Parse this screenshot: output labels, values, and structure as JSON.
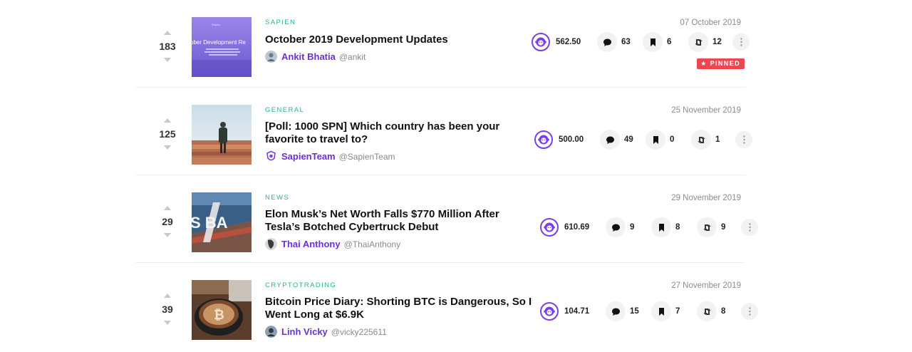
{
  "posts": [
    {
      "votes": "183",
      "category": "SAPIEN",
      "title": "October 2019 Development Updates",
      "author": "Ankit Bhatia",
      "handle": "@ankit",
      "date": "07 October 2019",
      "spn": "562.50",
      "comments": "63",
      "bookmarks": "6",
      "reposts": "12",
      "pinned": "PINNED",
      "thumb_text": "ober Development Re"
    },
    {
      "votes": "125",
      "category": "GENERAL",
      "title": "[Poll: 1000 SPN] Which country has been your favorite to travel to?",
      "author": "SapienTeam",
      "handle": "@SapienTeam",
      "date": "25 November 2019",
      "spn": "500.00",
      "comments": "49",
      "bookmarks": "0",
      "reposts": "1"
    },
    {
      "votes": "29",
      "category": "NEWS",
      "title": "Elon Musk’s Net Worth Falls $770 Million After Tesla’s Botched Cybertruck Debut",
      "author": "Thai Anthony",
      "handle": "@ThaiAnthony",
      "date": "29 November 2019",
      "spn": "610.69",
      "comments": "9",
      "bookmarks": "8",
      "reposts": "9",
      "thumb_text": "S BA"
    },
    {
      "votes": "39",
      "category": "CRYPTOTRADING",
      "title": "Bitcoin Price Diary: Shorting BTC is Dangerous, So I Went Long at $6.9K",
      "author": "Linh Vicky",
      "handle": "@vicky225611",
      "date": "27 November 2019",
      "spn": "104.71",
      "comments": "15",
      "bookmarks": "7",
      "reposts": "8"
    }
  ],
  "colors": {
    "accent": "#6b2fd6",
    "category": "#22b59a",
    "pinned": "#e9484f",
    "coin_ring": "#7b3fe4"
  },
  "icons": {
    "upvote": "chevron-up-icon",
    "downvote": "chevron-down-icon",
    "spn": "ape-coin-icon",
    "comments": "comment-bubble-icon",
    "bookmark": "bookmark-icon",
    "repost": "repost-icon",
    "more": "more-vertical-icon",
    "pinned": "star-icon"
  }
}
